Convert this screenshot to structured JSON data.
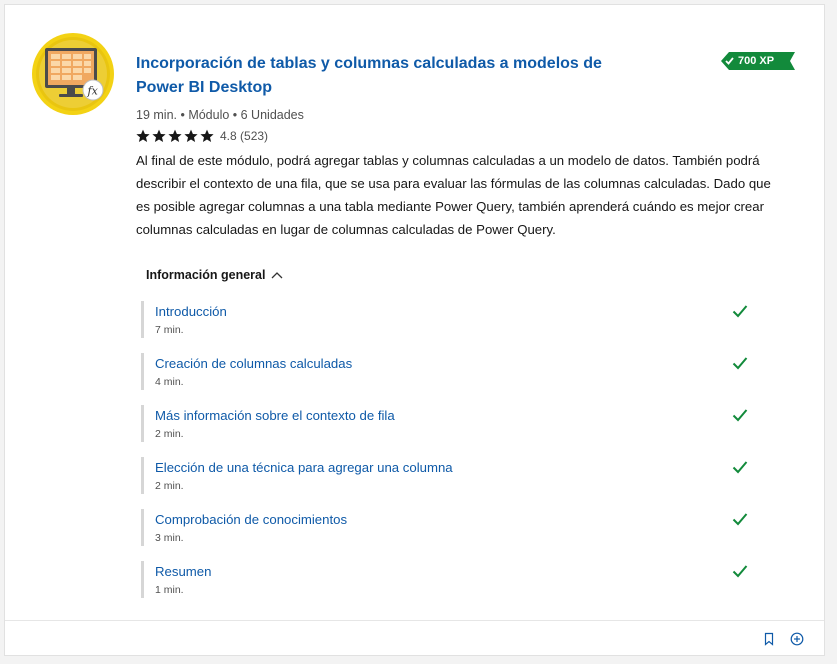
{
  "module": {
    "title": "Incorporación de tablas y columnas calculadas a modelos de Power BI Desktop",
    "icon": "spreadsheet-monitor-fx-icon",
    "xp": "700 XP",
    "meta": "19 min. • Módulo • 6 Unidades",
    "rating_value": "4.8",
    "rating_count": "(523)",
    "stars": 5,
    "description": "Al final de este módulo, podrá agregar tablas y columnas calculadas a un modelo de datos. También podrá describir el contexto de una fila, que se usa para evaluar las fórmulas de las columnas calculadas. Dado que es posible agregar columnas a una tabla mediante Power Query, también aprenderá cuándo es mejor crear columnas calculadas en lugar de columnas calculadas de Power Query."
  },
  "overview": {
    "label": "Información general",
    "expanded": true
  },
  "units": [
    {
      "title": "Introducción",
      "time": "7 min.",
      "completed": true
    },
    {
      "title": "Creación de columnas calculadas",
      "time": "4 min.",
      "completed": true
    },
    {
      "title": "Más información sobre el contexto de fila",
      "time": "2 min.",
      "completed": true
    },
    {
      "title": "Elección de una técnica para agregar una columna",
      "time": "2 min.",
      "completed": true
    },
    {
      "title": "Comprobación de conocimientos",
      "time": "3 min.",
      "completed": true
    },
    {
      "title": "Resumen",
      "time": "1 min.",
      "completed": true
    }
  ],
  "footer": {
    "bookmark_icon": "bookmark-icon",
    "add_icon": "add-circle-icon"
  },
  "colors": {
    "link": "#0f5aa8",
    "xp_badge": "#128a3b",
    "check": "#128a3b",
    "badge_ring": "#f5d015"
  }
}
